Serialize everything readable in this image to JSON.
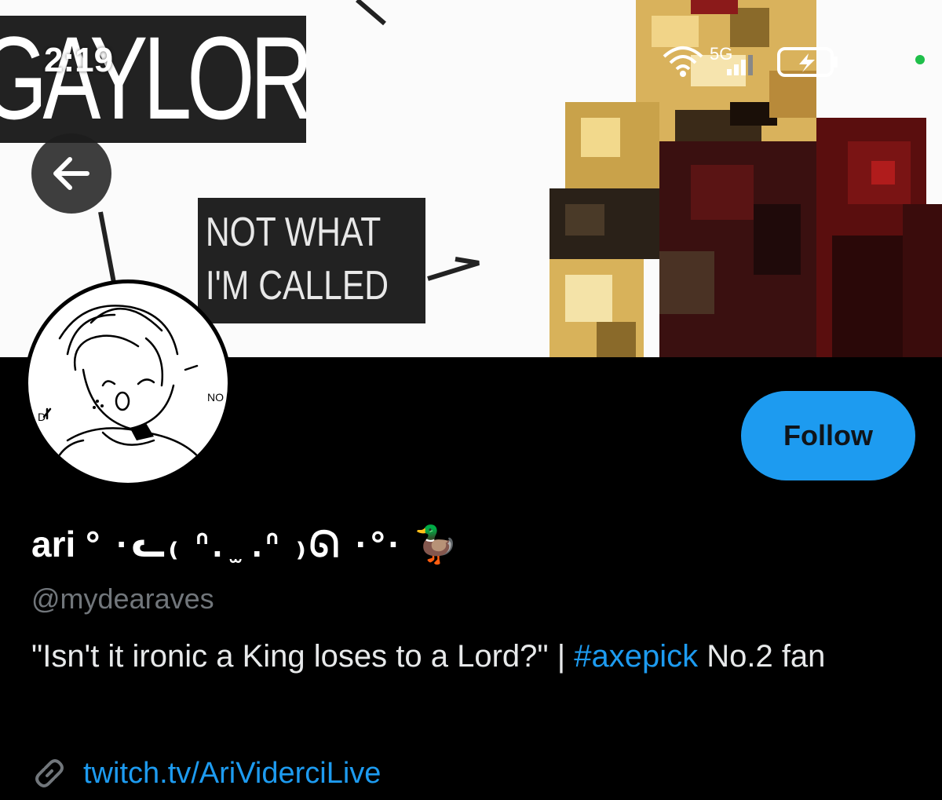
{
  "status_bar": {
    "time": "2:19",
    "network": "5G",
    "icons": [
      "wifi-icon",
      "signal-icon",
      "battery-charging-icon"
    ]
  },
  "banner": {
    "title_text": "GAYLORD",
    "caption_line1": "NOT WHAT",
    "caption_line2": "I'M CALLED"
  },
  "profile": {
    "display_name": "ari",
    "display_name_deco": "° ·ᓚ₍ ᐢ. ̫ .ᐢ ₎ᘏ ·°·",
    "display_name_emoji": "🦆",
    "username": "@mydearaves",
    "bio_before": "\"Isn't it ironic a King loses to a Lord?\" | ",
    "bio_hashtag": "#axepick",
    "bio_after": " No.2 fan",
    "link": "twitch.tv/AriViderciLive",
    "follow_label": "Follow"
  },
  "colors": {
    "accent": "#1d9bf0",
    "background": "#000000",
    "muted": "#71767b"
  }
}
